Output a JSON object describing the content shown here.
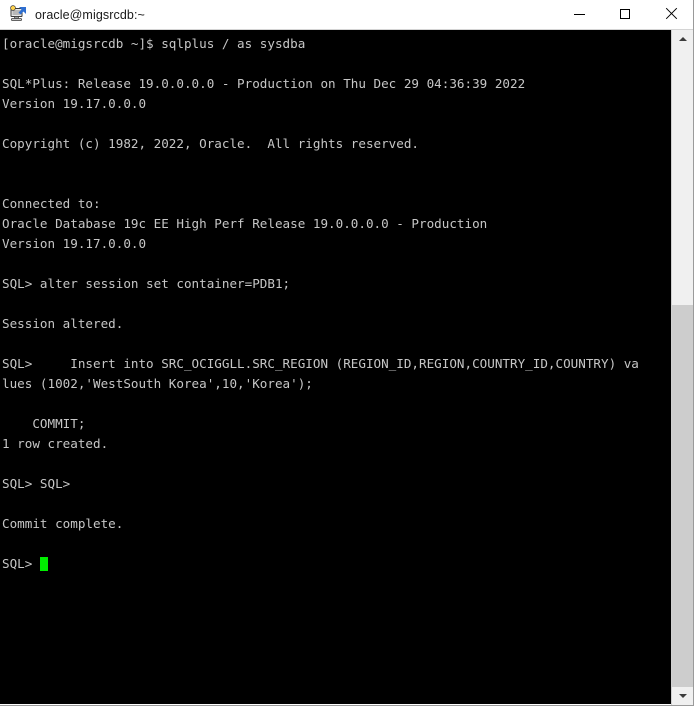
{
  "window": {
    "title": "oracle@migsrcdb:~",
    "icon": "putty-terminal-icon",
    "minimize_label": "Minimize",
    "maximize_label": "Maximize",
    "close_label": "Close"
  },
  "colors": {
    "terminal_background": "#000000",
    "terminal_foreground": "#c6c6c6",
    "cursor": "#00ee00",
    "titlebar_background": "#ffffff",
    "scrollbar_track": "#f0f0f0",
    "scrollbar_thumb": "#cdcdcd"
  },
  "scrollbar": {
    "up_arrow": "chevron-up-icon",
    "down_arrow": "chevron-down-icon"
  },
  "terminal": {
    "lines": [
      "[oracle@migsrcdb ~]$ sqlplus / as sysdba",
      "",
      "SQL*Plus: Release 19.0.0.0.0 - Production on Thu Dec 29 04:36:39 2022",
      "Version 19.17.0.0.0",
      "",
      "Copyright (c) 1982, 2022, Oracle.  All rights reserved.",
      "",
      "",
      "Connected to:",
      "Oracle Database 19c EE High Perf Release 19.0.0.0.0 - Production",
      "Version 19.17.0.0.0",
      "",
      "SQL> alter session set container=PDB1;",
      "",
      "Session altered.",
      "",
      "SQL>     Insert into SRC_OCIGGLL.SRC_REGION (REGION_ID,REGION,COUNTRY_ID,COUNTRY) va",
      "lues (1002,'WestSouth Korea',10,'Korea');",
      "",
      "    COMMIT;",
      "1 row created.",
      "",
      "SQL> SQL>",
      "",
      "Commit complete.",
      "",
      "SQL> "
    ],
    "cursor_line_index": 26,
    "prompt": "SQL> "
  }
}
